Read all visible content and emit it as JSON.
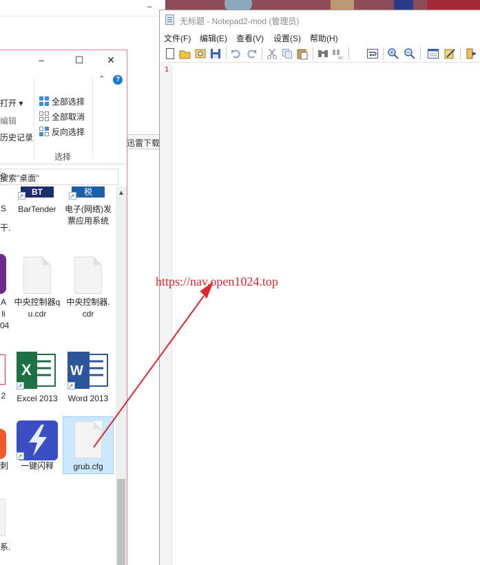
{
  "background_window": {
    "tab_partial_label": "迅雷下载"
  },
  "explorer": {
    "ribbon": {
      "open_label": "打开 ▾",
      "edit_label": "编辑",
      "history_label": "历史记录",
      "select_all": "全部选择",
      "select_none": "全部取消",
      "invert_selection": "反向选择",
      "group_label": "选择"
    },
    "search_placeholder": "搜索\"桌面\"",
    "files": [
      {
        "label": "BarTender",
        "icon": "bartender-icon"
      },
      {
        "label": "电子(网络)发票应用系统",
        "icon": "invoice-app-icon"
      },
      {
        "label": "中央控制器qu.cdr",
        "icon": "document-icon"
      },
      {
        "label": "中央控制器.cdr",
        "icon": "document-icon"
      },
      {
        "label": "Excel 2013",
        "icon": "excel-icon"
      },
      {
        "label": "Word 2013",
        "icon": "word-icon"
      },
      {
        "label": "一键闪释",
        "icon": "flash-release-icon"
      },
      {
        "label": "grub.cfg",
        "icon": "document-icon",
        "selected": true
      }
    ],
    "partial_left_labels": [
      "S",
      "干.",
      "A",
      "li",
      "04",
      "2",
      "刺",
      "系."
    ]
  },
  "notepad": {
    "title": "无标题 - Notepad2-mod (管理员)",
    "menu": [
      "文件(F)",
      "编辑(E)",
      "查看(V)",
      "设置(S)",
      "帮助(H)"
    ],
    "line_number": "1"
  },
  "annotation": {
    "url": "https://nav.open1024.top",
    "color": "#e0262a"
  },
  "colors": {
    "selection_bg": "#cce8ff",
    "explorer_border": "#e87a9a",
    "watermark": "#e0262a"
  }
}
